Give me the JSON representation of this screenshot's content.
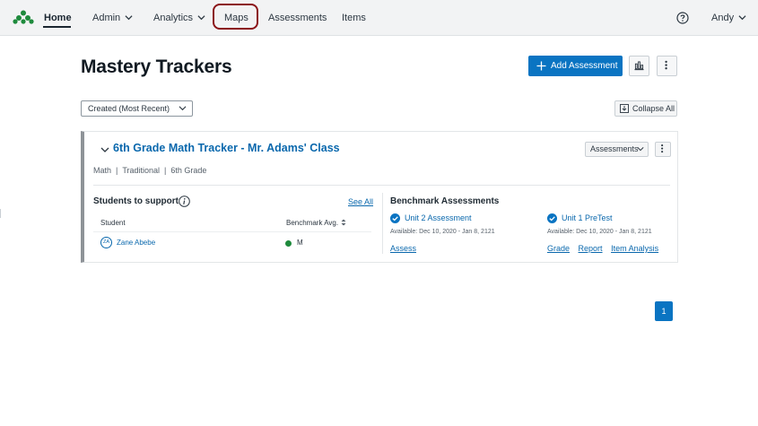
{
  "nav": {
    "home": "Home",
    "admin": "Admin",
    "analytics": "Analytics",
    "maps": "Maps",
    "assessments": "Assessments",
    "items": "Items",
    "help_icon": "question-circle-icon",
    "user": "Andy"
  },
  "page": {
    "title": "Mastery Trackers",
    "add_button": "Add Assessment",
    "sort_value": "Created (Most Recent)",
    "collapse_all": "Collapse All"
  },
  "tracker": {
    "title": "6th Grade Math Tracker - Mr. Adams' Class",
    "subject": "Math",
    "type": "Traditional",
    "grade": "6th Grade",
    "dropdown": "Assessments",
    "students_to_support": "Students to support",
    "see_all": "See All",
    "columns": {
      "student": "Student",
      "benchmark_avg": "Benchmark Avg."
    },
    "students": [
      {
        "initials": "ZA",
        "name": "Zane Abebe",
        "status": "M",
        "status_color": "#1e8a3c"
      }
    ],
    "benchmark_title": "Benchmark Assessments",
    "benchmarks": [
      {
        "name": "Unit 2 Assessment",
        "available": "Available: Dec 10, 2020 - Jan 8, 2121",
        "links": [
          "Assess"
        ]
      },
      {
        "name": "Unit 1 PreTest",
        "available": "Available: Dec 10, 2020 - Jan 8, 2121",
        "links": [
          "Grade",
          "Report",
          "Item Analysis"
        ]
      }
    ]
  },
  "pagination": {
    "current": "1"
  },
  "colors": {
    "accent": "#0a74c2",
    "link": "#0a68ad",
    "highlight": "#8b1318"
  }
}
